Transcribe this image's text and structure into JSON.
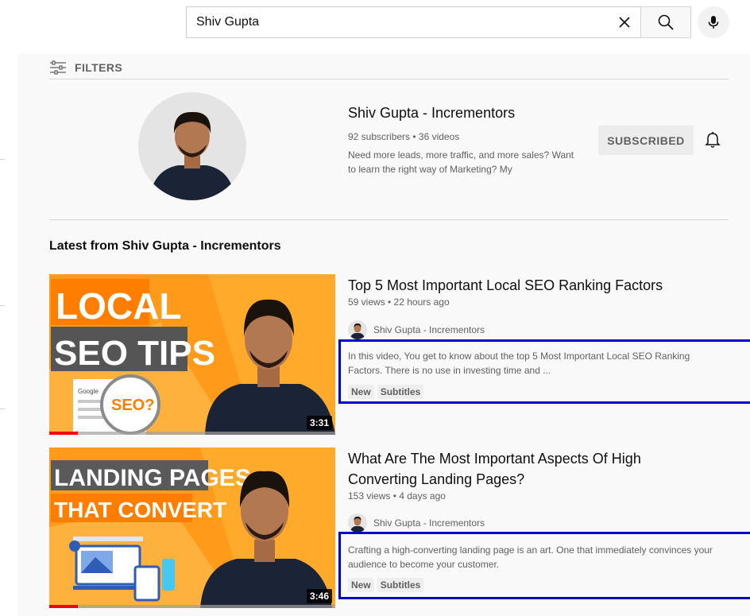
{
  "search": {
    "value": "Shiv Gupta",
    "placeholder": "Search"
  },
  "icons": {
    "clear": "close-icon",
    "search": "search-icon",
    "mic": "mic-icon",
    "filters": "tune-icon",
    "bell": "bell-icon"
  },
  "filters": {
    "label": "FILTERS"
  },
  "channel": {
    "name": "Shiv Gupta - Incrementors",
    "stats": "92 subscribers • 36 videos",
    "description": "Need more leads, more traffic, and more sales? Want to learn the right way of Marketing? My",
    "subscribe_label": "SUBSCRIBED"
  },
  "section": {
    "title": "Latest from Shiv Gupta - Incrementors"
  },
  "videos": [
    {
      "title": "Top 5 Most Important Local SEO Ranking Factors",
      "meta": "59 views • 22 hours ago",
      "channel": "Shiv Gupta - Incrementors",
      "description": "In this video, You get to know about the top 5 Most Important Local SEO Ranking Factors. There is no use in investing time and ...",
      "badges": [
        "New",
        "Subtitles"
      ],
      "duration": "3:31",
      "watched_fraction": 0.1,
      "thumb_line1": "LOCAL",
      "thumb_line2": "SEO TIPS",
      "thumb_badge": "SEO?",
      "thumb_small": "Google"
    },
    {
      "title": "What Are The Most Important Aspects Of High Converting Landing Pages?",
      "meta": "153 views • 4 days ago",
      "channel": "Shiv Gupta - Incrementors",
      "description": "Crafting a high-converting landing page is an art. One that immediately convinces your audience to become your customer.",
      "badges": [
        "New",
        "Subtitles"
      ],
      "duration": "3:46",
      "watched_fraction": 0.1,
      "thumb_line1": "LANDING PAGES",
      "thumb_line2": "THAT CONVERT"
    }
  ],
  "colors": {
    "highlight_box": "#0000cc",
    "thumb_orange": "#ff9a1a",
    "progress_red": "#ff0000"
  }
}
